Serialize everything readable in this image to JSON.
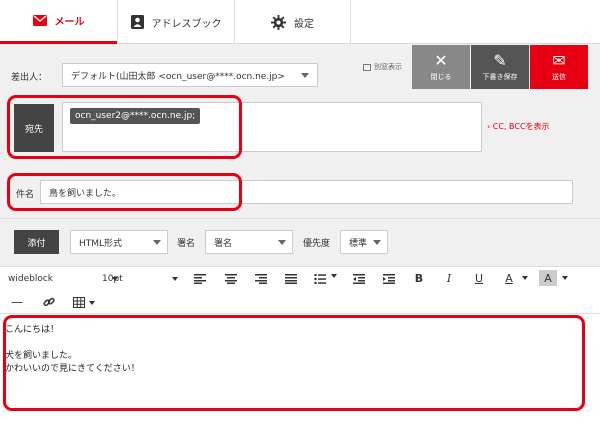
{
  "tabs": [
    {
      "label": "メール",
      "icon": "mail-icon"
    },
    {
      "label": "アドレスブック",
      "icon": "address-book-icon"
    },
    {
      "label": "設定",
      "icon": "gear-icon"
    }
  ],
  "header": {
    "from_label": "差出人：",
    "from_value": "デフォルト(山田太郎 <ocn_user@****.ocn.ne.jp>",
    "popout_label": "別窓表示",
    "close_label": "閉じる",
    "draft_label": "下書き保存",
    "send_label": "送信",
    "to_button": "宛先",
    "to_chip": "ocn_user2@****.ocn.ne.jp;",
    "cc_bcc_link": "CC, BCCを表示",
    "subject_label": "件名",
    "subject_value": "鳥を飼いました。"
  },
  "options": {
    "attach_label": "添付",
    "format_value": "HTML形式",
    "signature_label": "署名",
    "signature_value": "署名",
    "priority_label": "優先度",
    "priority_value": "標準"
  },
  "toolbar": {
    "font_family": "wideblock",
    "font_size": "10pt"
  },
  "editor": {
    "line1": "こんにちは！",
    "line2": "犬を飼いました。",
    "line3": "かわいいので見にきてください！"
  },
  "colors": {
    "accent": "#e60012",
    "dark": "#444444"
  }
}
